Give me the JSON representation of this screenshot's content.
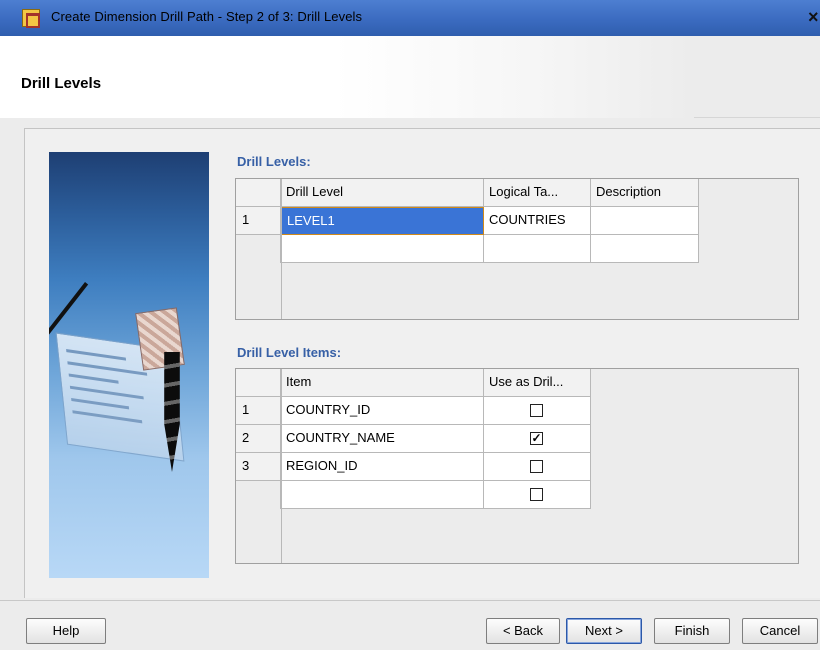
{
  "window": {
    "title": "Create Dimension Drill Path - Step 2 of 3: Drill Levels",
    "close_glyph": "×"
  },
  "header": {
    "title": "Drill Levels"
  },
  "drill_levels": {
    "label": "Drill Levels:",
    "columns": [
      "Drill Level",
      "Logical Ta...",
      "Description"
    ],
    "rows": [
      {
        "num": "1",
        "drill_level": "LEVEL1",
        "logical_table": "COUNTRIES",
        "description": ""
      },
      {
        "num": "",
        "drill_level": "",
        "logical_table": "",
        "description": ""
      }
    ]
  },
  "drill_level_items": {
    "label": "Drill Level Items:",
    "columns": [
      "Item",
      "Use as Dril..."
    ],
    "rows": [
      {
        "num": "1",
        "item": "COUNTRY_ID",
        "checked": false
      },
      {
        "num": "2",
        "item": "COUNTRY_NAME",
        "checked": true
      },
      {
        "num": "3",
        "item": "REGION_ID",
        "checked": false
      },
      {
        "num": "",
        "item": "",
        "checked": false
      }
    ]
  },
  "buttons": {
    "help": "Help",
    "back": "< Back",
    "next": "Next >",
    "finish": "Finish",
    "cancel": "Cancel"
  },
  "colors": {
    "title_bar": "#3b6bc0",
    "section_label": "#3760a6",
    "selection": "#3a74d6"
  },
  "icons": [
    "app-icon",
    "close-icon",
    "checkbox-icon"
  ]
}
